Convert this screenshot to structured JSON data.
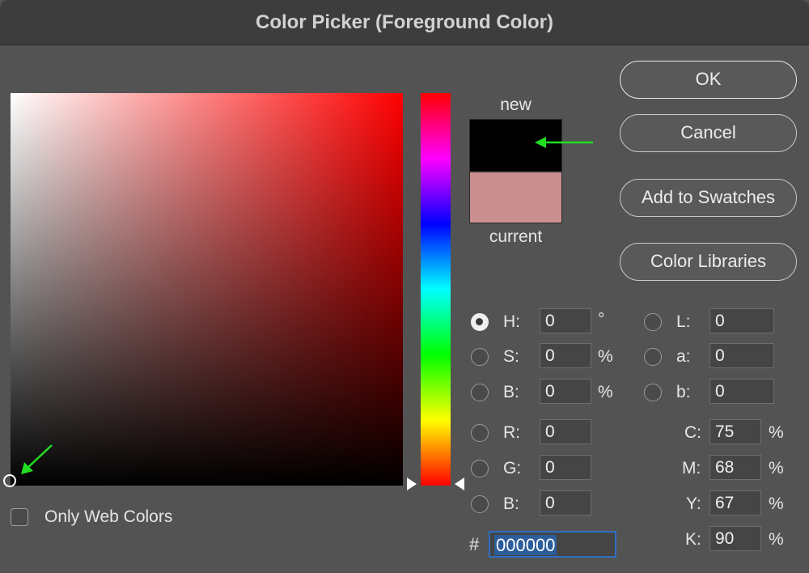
{
  "window": {
    "title": "Color Picker (Foreground Color)"
  },
  "preview": {
    "new_label": "new",
    "current_label": "current",
    "new_color": "#000000",
    "current_color": "#c98e8e"
  },
  "buttons": {
    "ok": "OK",
    "cancel": "Cancel",
    "add_to_swatches": "Add to Swatches",
    "color_libraries": "Color Libraries"
  },
  "hsb": {
    "selected": "H",
    "h": {
      "label": "H:",
      "value": "0",
      "unit": "°"
    },
    "s": {
      "label": "S:",
      "value": "0",
      "unit": "%"
    },
    "b": {
      "label": "B:",
      "value": "0",
      "unit": "%"
    }
  },
  "rgb": {
    "r": {
      "label": "R:",
      "value": "0"
    },
    "g": {
      "label": "G:",
      "value": "0"
    },
    "b": {
      "label": "B:",
      "value": "0"
    }
  },
  "lab": {
    "l": {
      "label": "L:",
      "value": "0"
    },
    "a": {
      "label": "a:",
      "value": "0"
    },
    "b": {
      "label": "b:",
      "value": "0"
    }
  },
  "cmyk": {
    "c": {
      "label": "C:",
      "value": "75",
      "unit": "%"
    },
    "m": {
      "label": "M:",
      "value": "68",
      "unit": "%"
    },
    "y": {
      "label": "Y:",
      "value": "67",
      "unit": "%"
    },
    "k": {
      "label": "K:",
      "value": "90",
      "unit": "%"
    }
  },
  "hex": {
    "sign": "#",
    "value": "000000"
  },
  "only_web_colors": {
    "label": "Only Web Colors",
    "checked": false
  },
  "annotation_arrow_color": "#22dd22"
}
